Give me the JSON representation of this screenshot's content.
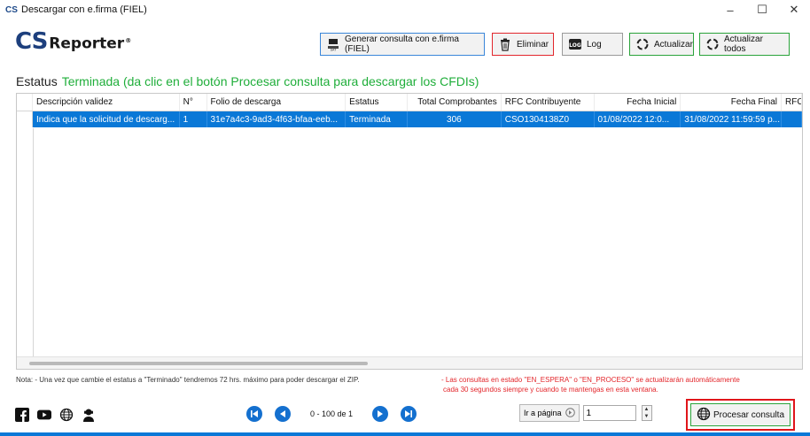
{
  "window": {
    "logo": "CS",
    "title": "Descargar con e.firma (FIEL)",
    "controls": {
      "minimize": "–",
      "maximize": "☐",
      "close": "✕"
    }
  },
  "brand": {
    "cs": "CS",
    "name": "Reporter",
    "reg": "®"
  },
  "toolbar": {
    "generar": "Generar consulta con e.firma (FIEL)",
    "eliminar": "Eliminar",
    "log": "Log",
    "actualizar": "Actualizar",
    "actualizar_todos": "Actualizar todos"
  },
  "status": {
    "label": "Estatus",
    "value": "Terminada (da clic en el botón Procesar consulta para descargar los CFDIs)"
  },
  "grid": {
    "columns": [
      "Descripción validez",
      "N°",
      "Folio de descarga",
      "Estatus",
      "Total Comprobantes",
      "RFC Contribuyente",
      "Fecha Inicial",
      "Fecha Final",
      "RFC"
    ],
    "rows": [
      [
        "Indica que la solicitud de descarg...",
        "1",
        "31e7a4c3-9ad3-4f63-bfaa-eeb...",
        "Terminada",
        "306",
        "CSO1304138Z0",
        "01/08/2022 12:0...",
        "31/08/2022 11:59:59 p...",
        ""
      ]
    ]
  },
  "notes": {
    "left": "Nota:  - Una vez que cambie el estatus a \"Terminado\" tendremos 72 hrs. máximo para poder descargar el ZIP.",
    "right_1": "- Las consultas en estado \"EN_ESPERA\" o \"EN_PROCESO\" se actualizarán automáticamente",
    "right_2": "cada 30 segundos siempre y cuando te mantengas en esta ventana."
  },
  "pager": {
    "info": "0 - 100 de 1"
  },
  "goto": {
    "label": "Ir a página",
    "value": "1"
  },
  "process": {
    "label": "Procesar consulta"
  },
  "colors": {
    "accent": "#0a78d7",
    "status_green": "#1fae3a",
    "note_red": "#e3262b",
    "brand_blue": "#1d3f7d"
  }
}
